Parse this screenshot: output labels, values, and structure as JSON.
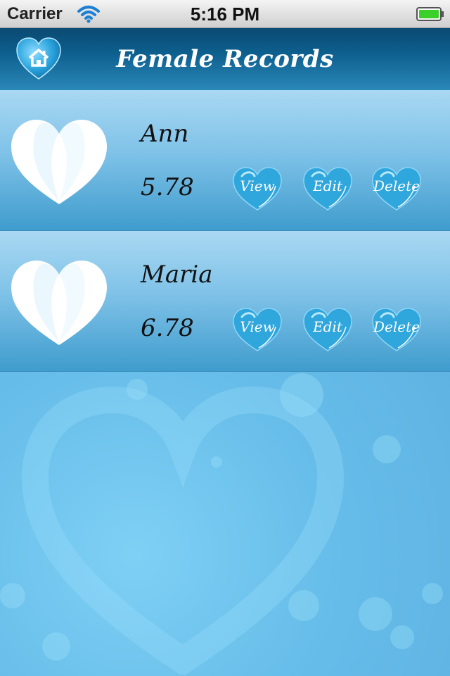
{
  "status_bar": {
    "carrier": "Carrier",
    "time": "5:16 PM",
    "wifi_icon": "wifi-icon",
    "battery_icon": "battery-full-icon"
  },
  "header": {
    "title": "Female Records",
    "home_icon": "home-heart-icon"
  },
  "records": [
    {
      "name": "Ann",
      "value": "5.78",
      "view_label": "View",
      "edit_label": "Edit",
      "delete_label": "Delete"
    },
    {
      "name": "Maria",
      "value": "6.78",
      "view_label": "View",
      "edit_label": "Edit",
      "delete_label": "Delete"
    }
  ],
  "colors": {
    "header_dark": "#0a4a72",
    "row_light": "#a9d8f2",
    "row_dark": "#3f9ccd",
    "button_heart": "#2fa6dc",
    "background": "#6fc3ec",
    "battery_green": "#3bd12a"
  }
}
